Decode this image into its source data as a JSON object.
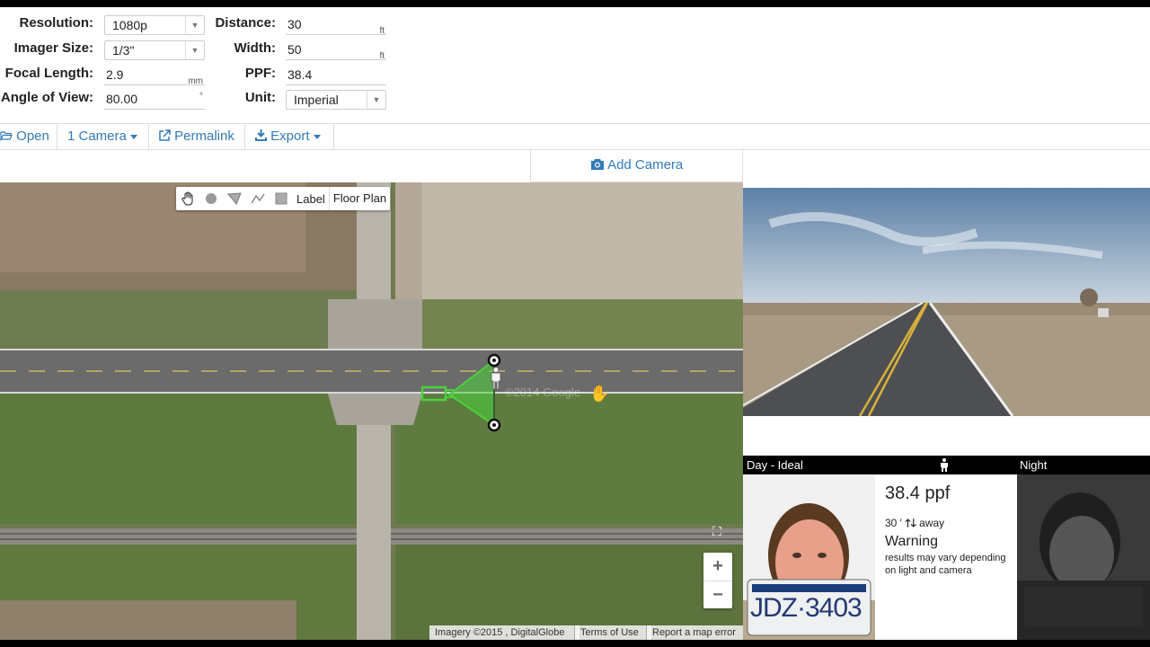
{
  "form": {
    "resolution": {
      "label": "Resolution:",
      "value": "1080p"
    },
    "imager_size": {
      "label": "Imager Size:",
      "value": "1/3\""
    },
    "focal_length": {
      "label": "Focal Length:",
      "value": "2.9",
      "unit": "mm"
    },
    "angle_of_view": {
      "label": "Angle of View:",
      "value": "80.00",
      "unit": "°"
    },
    "distance": {
      "label": "Distance:",
      "value": "30",
      "unit": "ft"
    },
    "width": {
      "label": "Width:",
      "value": "50",
      "unit": "ft"
    },
    "ppf": {
      "label": "PPF:",
      "value": "38.4"
    },
    "unit": {
      "label": "Unit:",
      "value": "Imperial"
    }
  },
  "toolbar": {
    "open": "Open",
    "cameras": "1 Camera",
    "permalink": "Permalink",
    "export": "Export"
  },
  "add_camera": "Add Camera",
  "map": {
    "tools": {
      "label": "Label",
      "floor_plan": "Floor Plan"
    },
    "zoom_in": "+",
    "zoom_out": "−",
    "attribution": "Imagery ©2015 , DigitalGlobe",
    "terms": "Terms of Use",
    "report": "Report a map error",
    "watermark": "©2014 Google"
  },
  "preview": {
    "day_label": "Day - Ideal",
    "night_label": "Night",
    "ppf_text": "38.4 ppf",
    "distance_value": "30 '",
    "away_text": "away",
    "warning_title": "Warning",
    "warning_text": "results may vary depending on light and camera",
    "plate_text": "JDZ·3403"
  },
  "colors": {
    "link": "#337ab7",
    "camera_fov": "#4cd13a"
  },
  "icons": [
    "folder-open-icon",
    "share-icon",
    "download-icon",
    "camera-icon",
    "hand-icon",
    "circle-icon",
    "polygon-icon",
    "line-icon",
    "square-icon",
    "person-icon",
    "arrow-up-icon",
    "arrow-down-icon"
  ]
}
